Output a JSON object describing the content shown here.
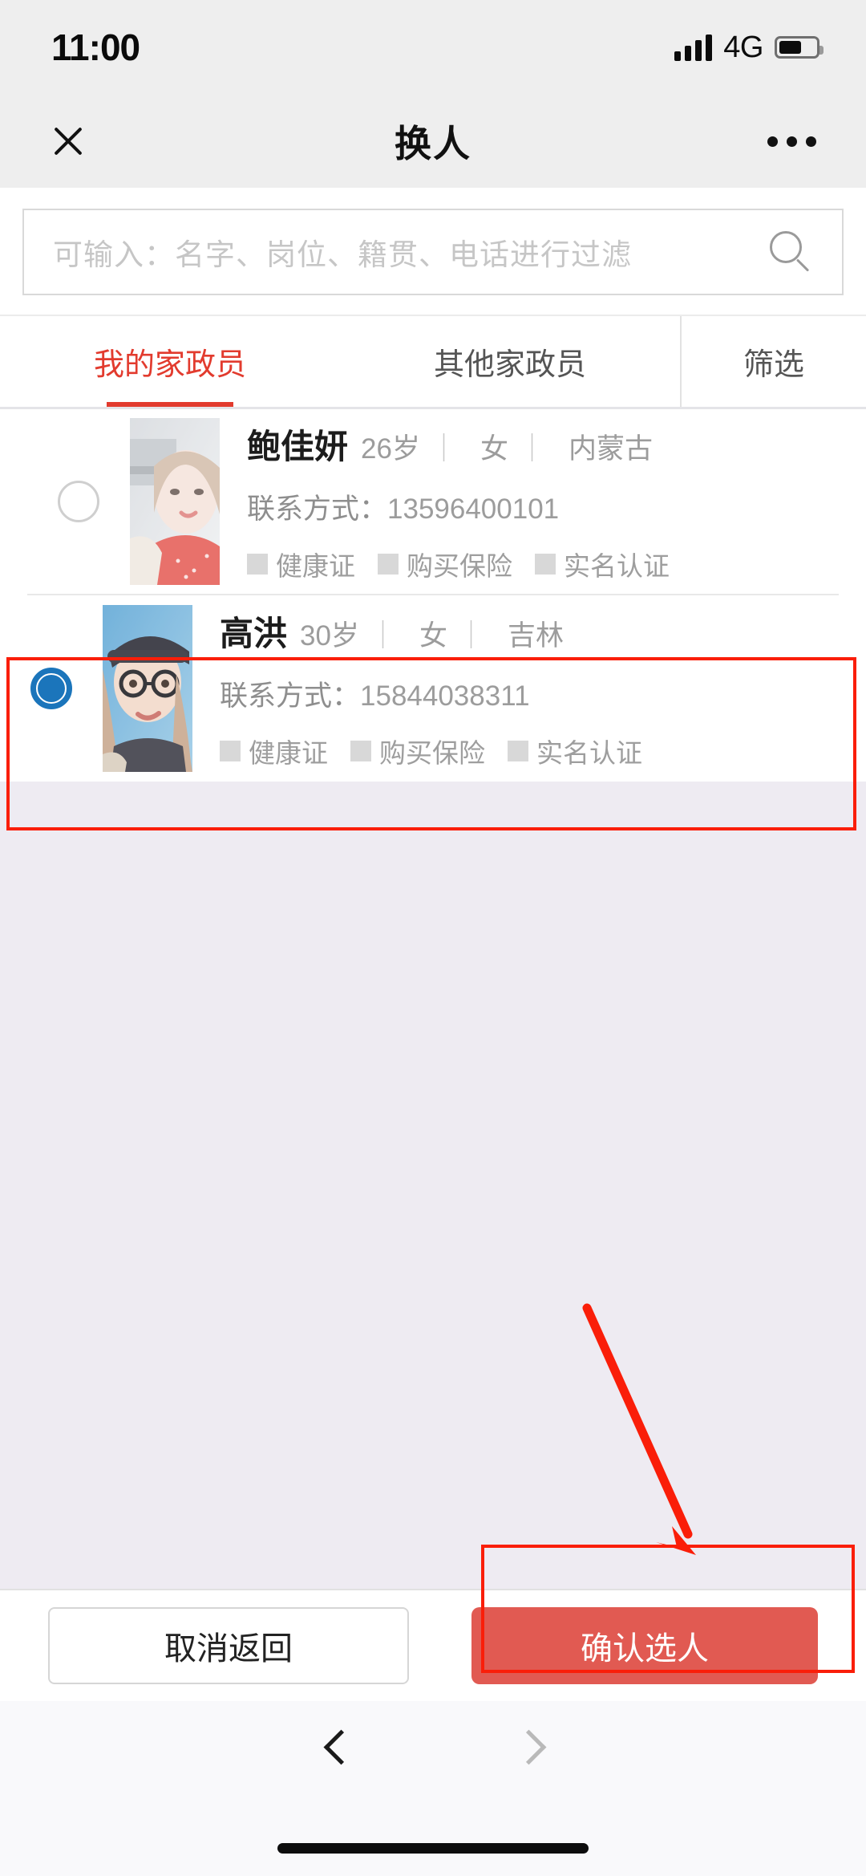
{
  "statusbar": {
    "time": "11:00",
    "network": "4G",
    "signal_icon": "signal-bars-icon",
    "battery_icon": "battery-icon"
  },
  "navbar": {
    "close_icon": "close-icon",
    "title": "换人",
    "more_icon": "more-options-icon"
  },
  "search": {
    "placeholder": "可输入：名字、岗位、籍贯、电话进行过滤",
    "value": "",
    "icon": "search-icon"
  },
  "tabs": [
    {
      "label": "我的家政员",
      "active": true
    },
    {
      "label": "其他家政员",
      "active": false
    },
    {
      "label": "筛选",
      "active": false
    }
  ],
  "list": {
    "people": [
      {
        "name": "鲍佳妍",
        "age": "26岁",
        "gender": "女",
        "hometown": "内蒙古",
        "contact_label": "联系方式：",
        "contact_value": "13596400101",
        "selected": false,
        "tags": [
          "健康证",
          "购买保险",
          "实名认证"
        ]
      },
      {
        "name": "高洪",
        "age": "30岁",
        "gender": "女",
        "hometown": "吉林",
        "contact_label": "联系方式：",
        "contact_value": "15844038311",
        "selected": true,
        "tags": [
          "健康证",
          "购买保险",
          "实名认证"
        ]
      }
    ],
    "separator": "｜"
  },
  "bottombar": {
    "cancel_label": "取消返回",
    "confirm_label": "确认选人"
  },
  "browsernav": {
    "back_icon": "chevron-left-icon",
    "forward_icon": "chevron-right-icon",
    "home_indicator": "home-indicator"
  },
  "colors": {
    "accent_red": "#e23b2e",
    "confirm_red": "#e15a52",
    "annotation_red": "#fa1e09",
    "radio_blue": "#1b75bb",
    "page_bg": "#eeebf2",
    "bar_bg": "#eeeeee"
  }
}
